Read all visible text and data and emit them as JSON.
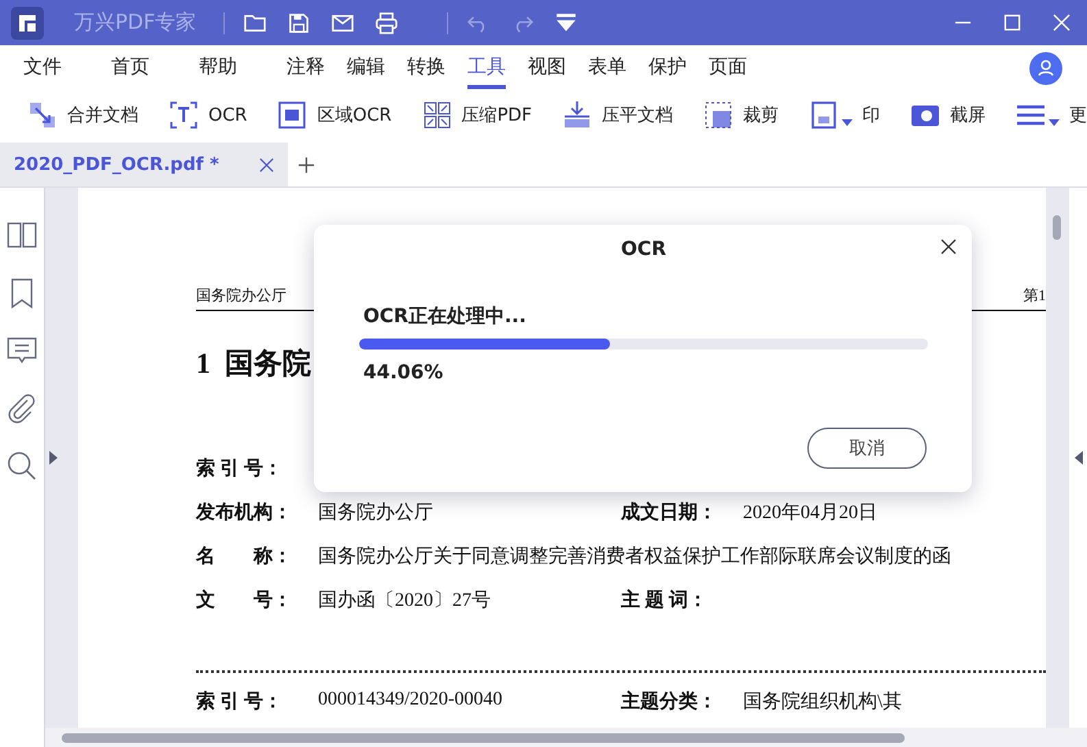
{
  "app": {
    "title": "万兴PDF专家"
  },
  "menu": [
    {
      "label": "文件",
      "selected": false
    },
    {
      "label": "首页",
      "selected": false
    },
    {
      "label": "帮助",
      "selected": false
    },
    {
      "label": "注释",
      "selected": false
    },
    {
      "label": "编辑",
      "selected": false
    },
    {
      "label": "转换",
      "selected": false
    },
    {
      "label": "工具",
      "selected": true
    },
    {
      "label": "视图",
      "selected": false
    },
    {
      "label": "表单",
      "selected": false
    },
    {
      "label": "保护",
      "selected": false
    },
    {
      "label": "页面",
      "selected": false
    }
  ],
  "toolbar": [
    {
      "label": "合并文档",
      "dropdown": false
    },
    {
      "label": "OCR",
      "dropdown": false
    },
    {
      "label": "区域OCR",
      "dropdown": false
    },
    {
      "label": "压缩PDF",
      "dropdown": false
    },
    {
      "label": "压平文档",
      "dropdown": false
    },
    {
      "label": "裁剪",
      "dropdown": false
    },
    {
      "label": "印",
      "dropdown": true
    },
    {
      "label": "截屏",
      "dropdown": false
    },
    {
      "label": "更",
      "dropdown": true
    }
  ],
  "tabs": [
    {
      "label": "2020_PDF_OCR.pdf *",
      "selected": true
    }
  ],
  "document": {
    "header_left": "国务院办公厅",
    "header_right": "第1",
    "heading": "1  国务院",
    "rows": [
      [
        {
          "label": "索 引 号："
        }
      ],
      [
        {
          "label": "发布机构：",
          "value": "国务院办公厅"
        },
        {
          "label": "成文日期：",
          "value": "2020年04月20日"
        }
      ],
      [
        {
          "label": "名　　称：",
          "value": "国务院办公厅关于同意调整完善消费者权益保护工作部际联席会议制度的函"
        }
      ],
      [
        {
          "label": "文　　号：",
          "value": "国办函〔2020〕27号"
        },
        {
          "label": "主 题 词："
        }
      ]
    ],
    "rows_after_divider": [
      [
        {
          "label": "索 引 号：",
          "value": "000014349/2020-00040"
        },
        {
          "label": "主题分类：",
          "value": "国务院组织机构\\其"
        }
      ]
    ]
  },
  "dialog": {
    "title": "OCR",
    "status": "OCR正在处理中...",
    "progress": {
      "level": 0.4406,
      "reading": "44.06%"
    },
    "button": "取消"
  }
}
